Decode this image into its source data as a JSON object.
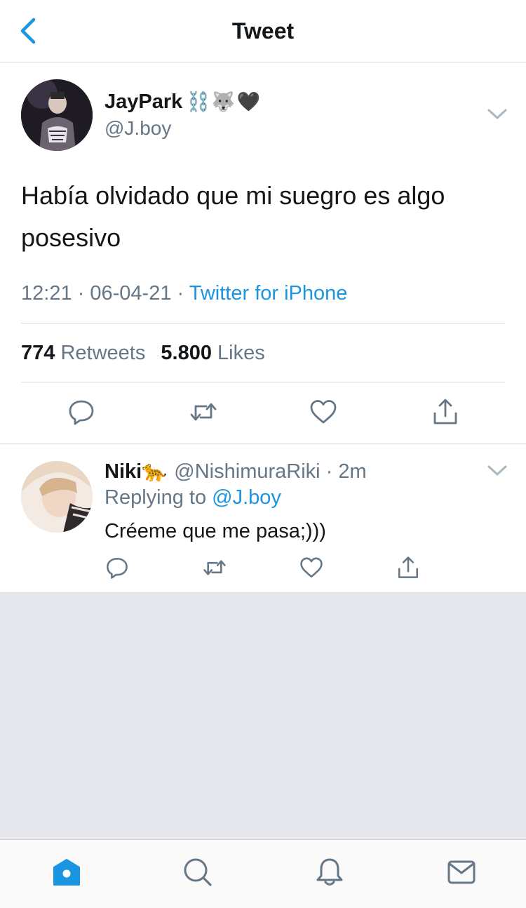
{
  "nav": {
    "title": "Tweet"
  },
  "tweet": {
    "author_name": "JayPark",
    "author_emoji": "⛓️🐺🖤",
    "author_handle": "@J.boy",
    "text": "Había olvidado que mi suegro es algo posesivo",
    "time": "12:21",
    "date": "06-04-21",
    "source": "Twitter for iPhone",
    "retweets_count": "774",
    "retweets_label": "Retweets",
    "likes_count": "5.800",
    "likes_label": "Likes"
  },
  "reply": {
    "author_name": "Niki",
    "author_emoji": "🐆",
    "author_handle": "@NishimuraRiki",
    "time": "2m",
    "replying_prefix": "Replying to",
    "replying_to": "@J.boy",
    "text": "Créeme que me pasa;)))"
  },
  "colors": {
    "accent": "#1b95e0",
    "icon_gray": "#657786",
    "text": "#14171a",
    "divider": "#d8dde2",
    "empty_bg": "#e6e8ee"
  },
  "icons": {
    "back": "chevron-left-icon",
    "reply": "reply-icon",
    "retweet": "retweet-icon",
    "like": "heart-icon",
    "share": "share-icon",
    "home": "home-icon",
    "search": "search-icon",
    "notifications": "bell-icon",
    "messages": "mail-icon"
  }
}
